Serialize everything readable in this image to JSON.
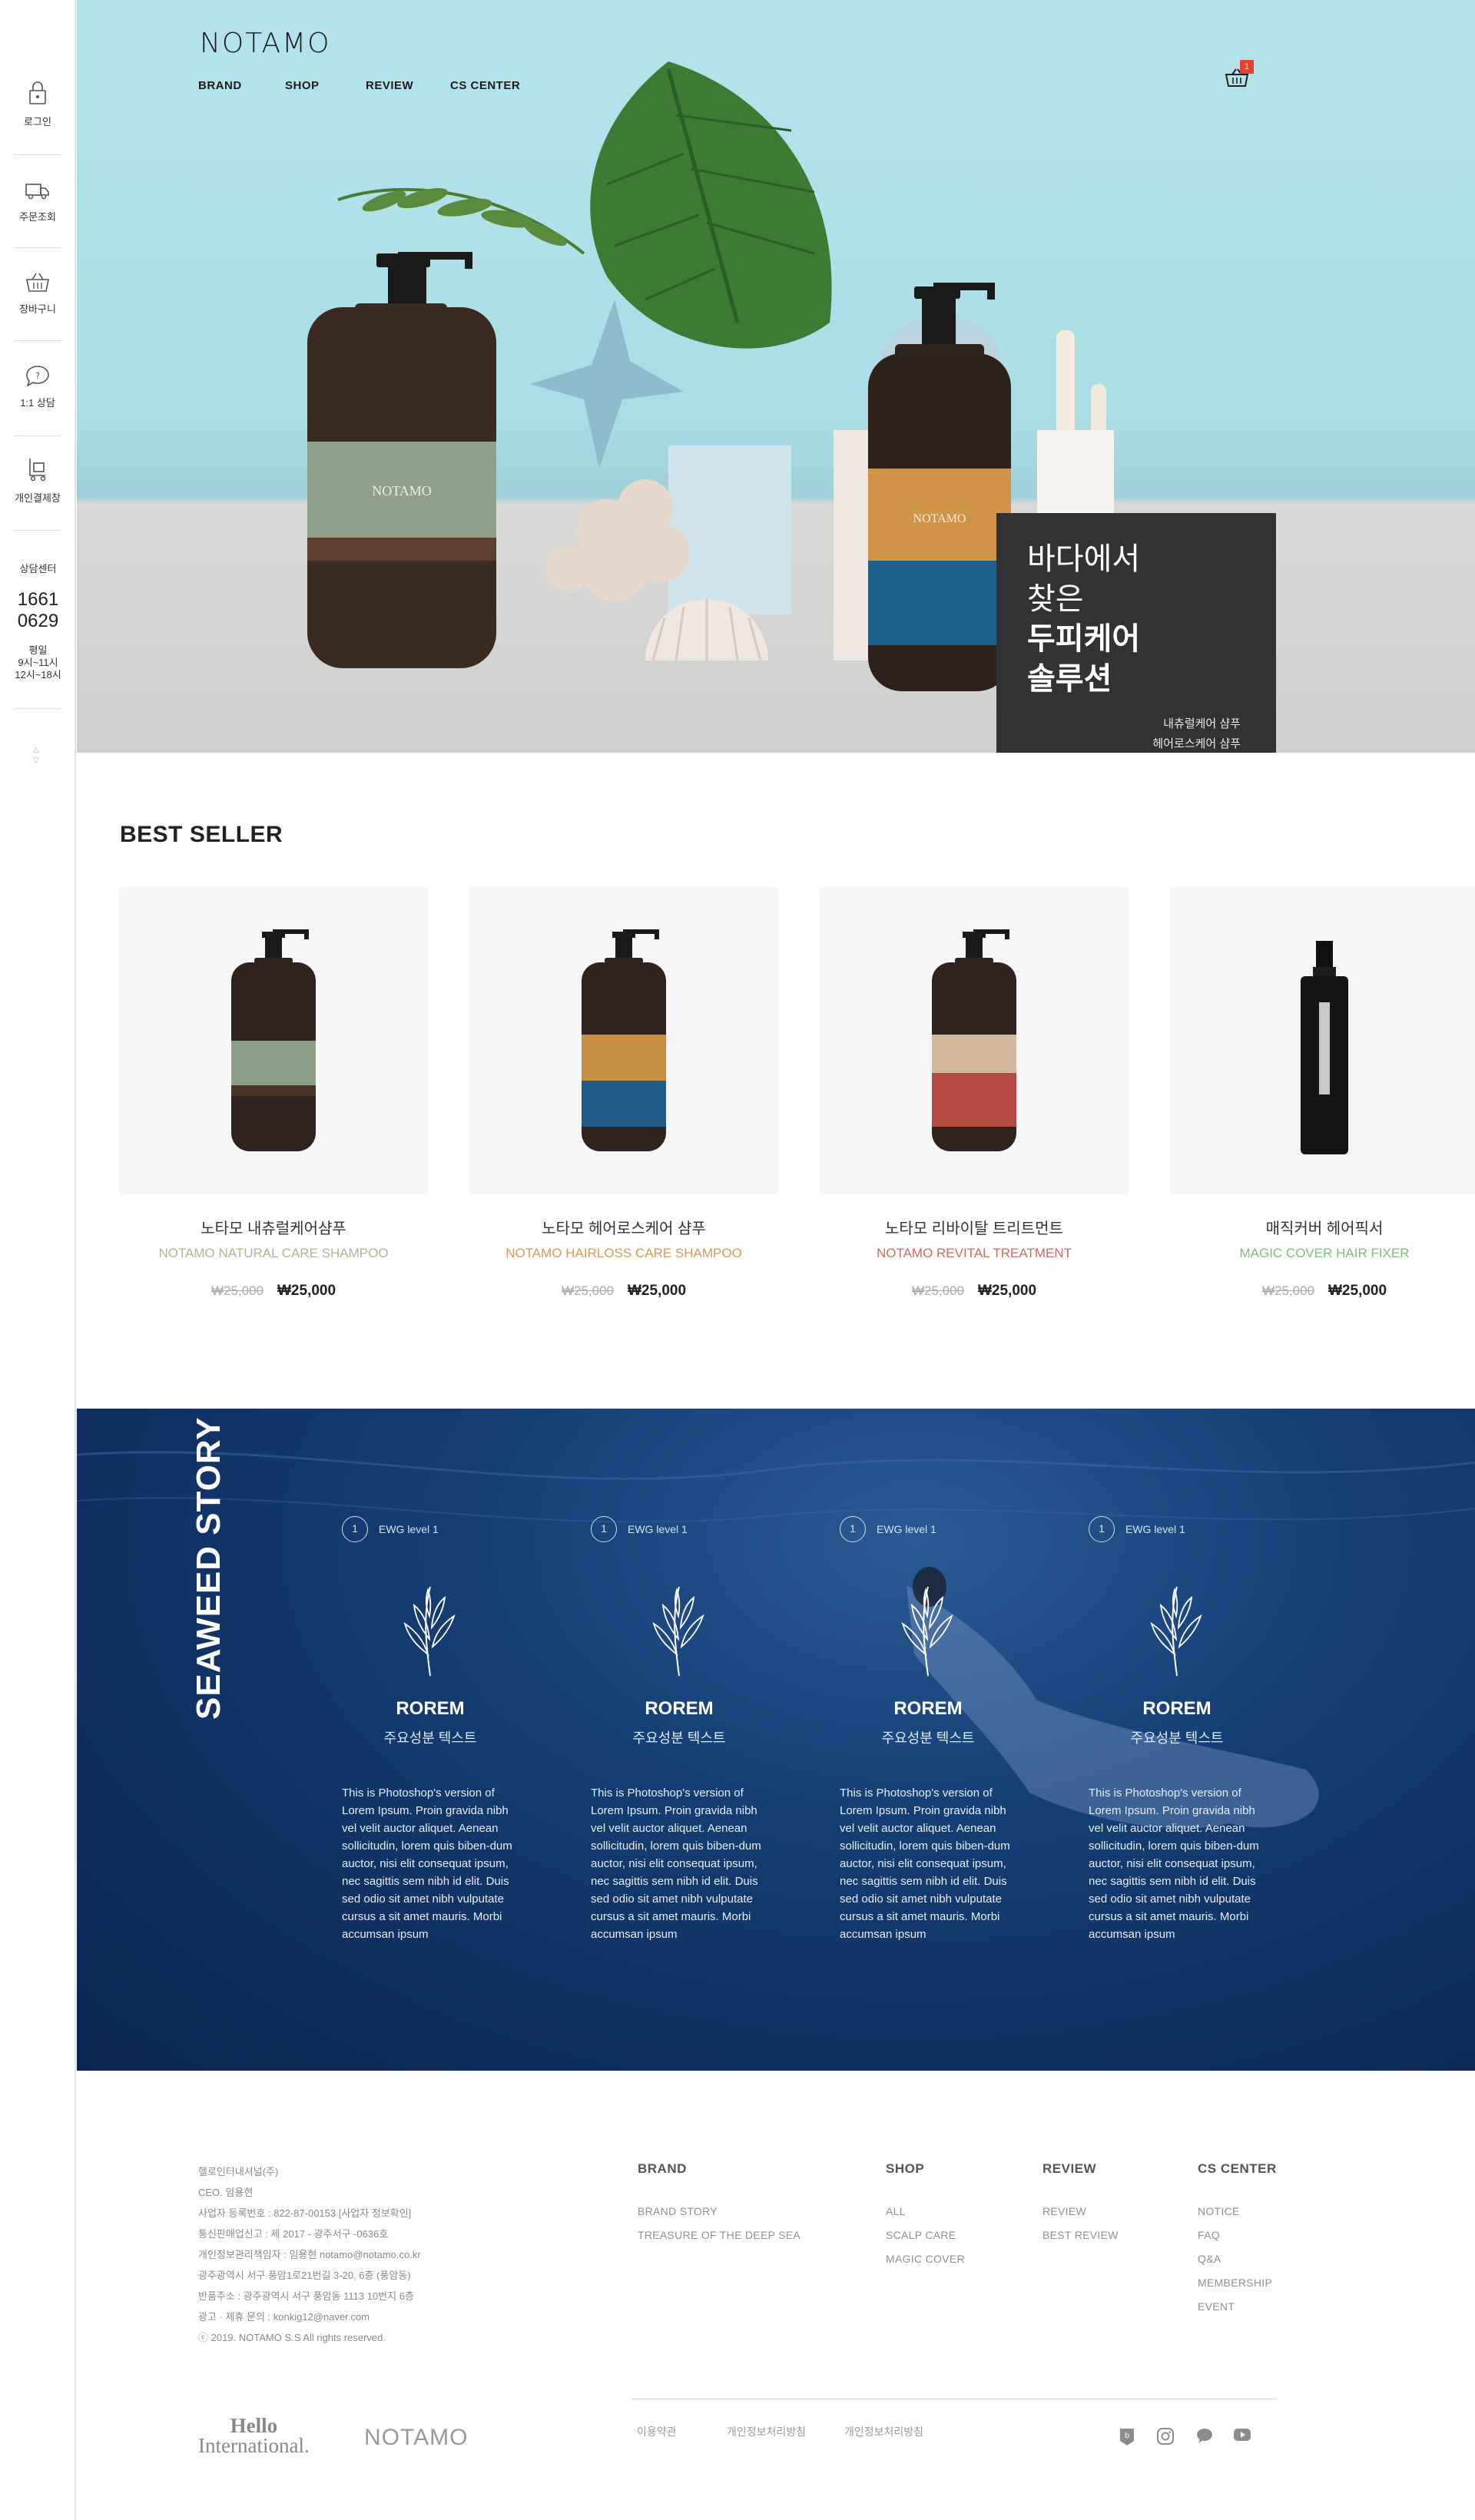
{
  "sidebar": {
    "items": [
      {
        "label": "로그인",
        "icon": "lock-icon"
      },
      {
        "label": "주문조회",
        "icon": "truck-icon"
      },
      {
        "label": "장바구니",
        "icon": "basket-icon"
      },
      {
        "label": "1:1 상담",
        "icon": "chat-icon"
      },
      {
        "label": "개인결제창",
        "icon": "cart-icon"
      }
    ],
    "cs": {
      "title": "상담센터",
      "phone_1": "1661",
      "phone_2": "0629",
      "hours_1": "평일",
      "hours_2": "9시~11시",
      "hours_3": "12시~18시"
    }
  },
  "header": {
    "logo": "NOTAMO",
    "nav": [
      "BRAND",
      "SHOP",
      "REVIEW",
      "CS CENTER"
    ],
    "cart_count": "1"
  },
  "hero": {
    "line1": "바다에서",
    "line2": "찾은",
    "line3": "두피케어",
    "line4": "솔루션",
    "sub1": "내츄럴케어 샴푸",
    "sub2": "헤어로스케어 샴푸"
  },
  "best_seller": {
    "title": "BEST SELLER",
    "products": [
      {
        "name_ko": "노타모 내츄럴케어샴푸",
        "name_en": "NOTAMO NATURAL CARE SHAMPOO",
        "en_color": "#a9b79b",
        "old_price": "₩25,000",
        "price": "₩25,000"
      },
      {
        "name_ko": "노타모 헤어로스케어 샴푸",
        "name_en": "NOTAMO HAIRLOSS CARE SHAMPOO",
        "en_color": "#d79a5c",
        "old_price": "₩25,000",
        "price": "₩25,000"
      },
      {
        "name_ko": "노타모 리바이탈 트리트먼트",
        "name_en": "NOTAMO REVITAL TREATMENT",
        "en_color": "#cf6a5e",
        "old_price": "₩25,000",
        "price": "₩25,000"
      },
      {
        "name_ko": "매직커버 헤어픽서",
        "name_en": "MAGIC COVER HAIR FIXER",
        "en_color": "#7cbf7a",
        "old_price": "₩25,000",
        "price": "₩25,000"
      }
    ]
  },
  "seaweed": {
    "title": "SEAWEED STORY",
    "columns": [
      {
        "level_num": "1",
        "level": "EWG level 1",
        "name": "ROREM",
        "kor": "주요성분 텍스트",
        "desc": "This is Photoshop's version of Lorem Ipsum. Proin gravida nibh vel velit auctor aliquet. Aenean sollicitudin, lorem quis biben-dum auctor, nisi elit consequat ipsum, nec sagittis sem nibh id elit. Duis sed odio sit amet nibh vulputate cursus a sit amet mauris. Morbi accumsan ipsum"
      },
      {
        "level_num": "1",
        "level": "EWG level 1",
        "name": "ROREM",
        "kor": "주요성분 텍스트",
        "desc": "This is Photoshop's version of Lorem Ipsum. Proin gravida nibh vel velit auctor aliquet. Aenean sollicitudin, lorem quis biben-dum auctor, nisi elit consequat ipsum, nec sagittis sem nibh id elit. Duis sed odio sit amet nibh vulputate cursus a sit amet mauris. Morbi accumsan ipsum"
      },
      {
        "level_num": "1",
        "level": "EWG level 1",
        "name": "ROREM",
        "kor": "주요성분 텍스트",
        "desc": "This is Photoshop's version of Lorem Ipsum. Proin gravida nibh vel velit auctor aliquet. Aenean sollicitudin, lorem quis biben-dum auctor, nisi elit consequat ipsum, nec sagittis sem nibh id elit. Duis sed odio sit amet nibh vulputate cursus a sit amet mauris. Morbi accumsan ipsum"
      },
      {
        "level_num": "1",
        "level": "EWG level 1",
        "name": "ROREM",
        "kor": "주요성분 텍스트",
        "desc": "This is Photoshop's version of Lorem Ipsum. Proin gravida nibh vel velit auctor aliquet. Aenean sollicitudin, lorem quis biben-dum auctor, nisi elit consequat ipsum, nec sagittis sem nibh id elit. Duis sed odio sit amet nibh vulputate cursus a sit amet mauris. Morbi accumsan ipsum"
      }
    ]
  },
  "footer": {
    "company": [
      "헬로인터내셔널(주)",
      "CEO. 임용현",
      "사업자 등록번호 : 822-87-00153 [사업자 정보확인]",
      "통신판매업신고 : 제 2017 - 광주서구 -0636호",
      "개인정보관리책임자 : 임용현 notamo@notamo.co.kr",
      "광주광역시 서구 풍암1로21번길 3-20, 6층 (풍암동)",
      "반품주소 : 광주광역시 서구 풍암동 1113 10번지 6층",
      "광고 · 제휴 문의 : konkig12@naver.com",
      "ⓒ 2019. NOTAMO S.S All rights reserved."
    ],
    "menus": [
      {
        "heading": "BRAND",
        "items": [
          "BRAND STORY",
          "TREASURE OF THE DEEP SEA"
        ]
      },
      {
        "heading": "SHOP",
        "items": [
          "ALL",
          "SCALP CARE",
          "MAGIC COVER"
        ]
      },
      {
        "heading": "REVIEW",
        "items": [
          "REVIEW",
          "BEST REVIEW"
        ]
      },
      {
        "heading": "CS CENTER",
        "items": [
          "NOTICE",
          "FAQ",
          "Q&A",
          "MEMBERSHIP",
          "EVENT"
        ]
      }
    ],
    "hello_1": "Hello",
    "hello_2": "International.",
    "logo": "NOTAMO",
    "links": [
      "이용약관",
      "개인정보처리방침",
      "개인정보처리방침"
    ],
    "social": [
      "blog-icon",
      "instagram-icon",
      "talk-icon",
      "youtube-icon"
    ]
  }
}
